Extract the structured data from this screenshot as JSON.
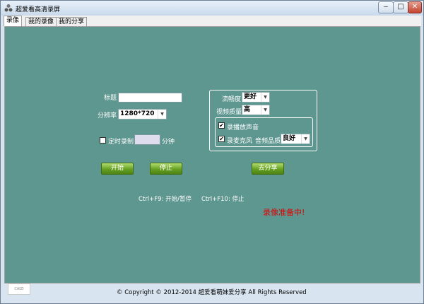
{
  "window": {
    "title": "超爱看高清录屏",
    "minimize_glyph": "‒",
    "maximize_glyph": "□",
    "close_glyph": "✕"
  },
  "tabs": [
    {
      "label": "录像",
      "active": true
    },
    {
      "label": "我的录像",
      "active": false
    },
    {
      "label": "我的分享",
      "active": false
    }
  ],
  "form": {
    "title_label": "标题",
    "title_value": "",
    "resolution_label": "分辨率",
    "resolution_value": "1280*720",
    "timer_checkbox_checked": false,
    "timer_label": "定时录制",
    "timer_value": "",
    "timer_unit": "分钟"
  },
  "settings": {
    "fluency_label": "流畅度",
    "fluency_value": "更好",
    "video_quality_label": "视频质量",
    "video_quality_value": "高",
    "record_system_audio_checked": true,
    "record_system_audio_label": "录播放声音",
    "record_mic_checked": true,
    "record_mic_label": "录麦克风",
    "audio_quality_label": "音频品质",
    "audio_quality_value": "良好"
  },
  "buttons": {
    "start": "开始",
    "stop": "停止",
    "share": "去分享"
  },
  "hotkeys": {
    "start_pause": "Ctrl+F9:  开始/暂停",
    "stop": "Ctrl+F10:  停止"
  },
  "status": "录像准备中!",
  "footer": {
    "copyright": "© Copyright © 2012-2014  超爱看萌妹爱分享  All Rights Reserved",
    "logo_text": "CAIZI"
  },
  "icons": {
    "app": "app-logo-icon",
    "dropdown": "chevron-down-icon",
    "check": "checkmark-icon"
  },
  "colors": {
    "panel_bg": "#5e9690",
    "button_green": "#66a022",
    "status_red": "#dd0000",
    "close_red": "#c4432f"
  }
}
